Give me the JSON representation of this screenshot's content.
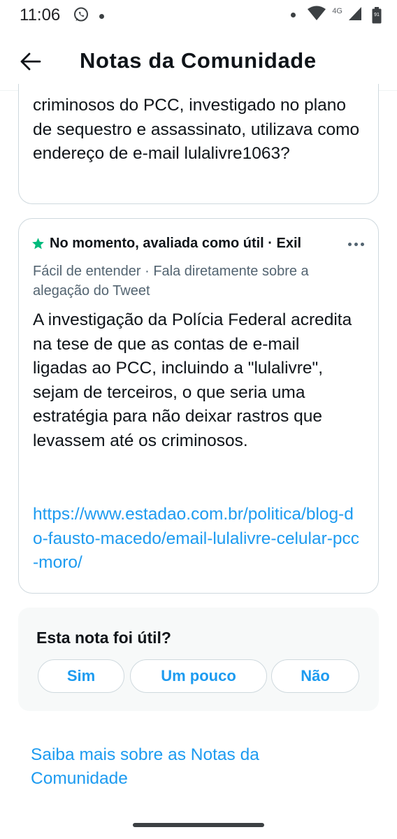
{
  "status_bar": {
    "time": "11:06",
    "network": "4G",
    "battery_level": "91",
    "icons": [
      "whatsapp-icon",
      "notification-dot-icon",
      "wifi-icon",
      "cell-signal-icon",
      "battery-icon"
    ]
  },
  "header": {
    "title": "Notas da Comunidade",
    "back_icon": "arrow-left-icon"
  },
  "tweet_card": {
    "text": "criminosos do PCC, investigado no plano de sequestro e assassinato, utilizava como endereço de e-mail lulalivre1063?"
  },
  "note": {
    "status_icon": "star-icon",
    "status_color": "#00ba7c",
    "status": "No momento, avaliada como útil",
    "shown": "· Exil",
    "tags": "Fácil de entender · Fala diretamente sobre a alegação do Tweet",
    "body": "A investigação da Polícia Federal acredita na tese de que as contas de e-mail ligadas ao PCC, incluindo a \"lulalivre\", sejam de terceiros, o que seria uma estratégia para não deixar rastros que levassem até os criminosos.",
    "link": "https://www.estadao.com.br/politica/blog-do-fausto-macedo/email-lulalivre-celular-pcc-moro/"
  },
  "rating": {
    "question": "Esta nota foi útil?",
    "yes": "Sim",
    "somewhat": "Um pouco",
    "no": "Não"
  },
  "footer": {
    "learn_more": "Saiba mais sobre as Notas da Comunidade"
  },
  "colors": {
    "accent": "#1d9bf0",
    "text_primary": "#0f1419",
    "text_secondary": "#536471",
    "border": "#cfd9de",
    "rating_bg": "#f7f9f9"
  }
}
